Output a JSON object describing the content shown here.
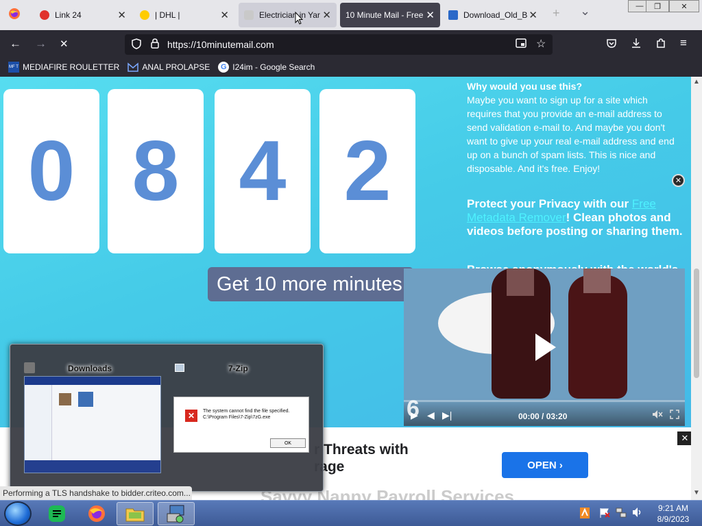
{
  "tabs": [
    {
      "label": "Link 24",
      "favicon_color": "#e0312b"
    },
    {
      "label": "| DHL |",
      "favicon_color": "#ffcc00"
    },
    {
      "label": "Electrician in Yar",
      "favicon_color": "#c9c9c9"
    },
    {
      "label": "10 Minute Mail - Free",
      "favicon_color": ""
    },
    {
      "label": "Download_Old_B",
      "favicon_color": "#2a68c8"
    }
  ],
  "tab_close_glyph": "✕",
  "new_tab_glyph": "+",
  "tab_list_glyph": "⌄",
  "window_controls": {
    "minimize": "—",
    "restore": "❐",
    "close": "✕"
  },
  "nav": {
    "back": "←",
    "forward": "→",
    "stop": "✕",
    "url": "https://10minutemail.com"
  },
  "bookmarks": [
    {
      "label": "MEDIAFIRE ROULETTER",
      "icon": "MF T"
    },
    {
      "label": "ANAL PROLAPSE",
      "icon": ""
    },
    {
      "label": "I24im - Google Search",
      "icon": "G"
    }
  ],
  "timer_digits": [
    "0",
    "8",
    "4",
    "2"
  ],
  "get_more_label": "Get 10 more minutes",
  "info": {
    "title": "Why would you use this?",
    "text": "Maybe you want to sign up for a site which requires that you provide an e-mail address to send validation e-mail to. And maybe you don't want to give up your real e-mail address and end up on a bunch of spam lists. This is nice and disposable. And it's free. Enjoy!",
    "privacy_prefix": "Protect your Privacy with our ",
    "privacy_link": "Free Metadata Remover",
    "privacy_suffix": "! Clean photos and videos before posting or sharing them.",
    "browse": "Browse anonymously with the world's"
  },
  "video": {
    "close_glyph": "✕",
    "time": "00:00 / 03:20",
    "badge": "6",
    "progress": 0
  },
  "banner": {
    "text_line1": "r Threats with",
    "text_line2": "rage",
    "open_label": "OPEN ›",
    "close_glyph": "✕",
    "behind_text": "Savvy Nanny Payroll Services"
  },
  "preview": {
    "window1_title": "Downloads",
    "window2_title": "7-Zip",
    "error_line1": "The system cannot find the file specified.",
    "error_line2": "C:\\Program Files\\7-Zip\\7zG.exe",
    "ok_label": "OK",
    "error_glyph": "✕"
  },
  "status_text": "Performing a TLS handshake to bidder.criteo.com...",
  "clock": {
    "time": "9:21 AM",
    "date": "8/9/2023"
  },
  "colors": {
    "accent_blue": "#1a73e8",
    "digit": "#5b8ed6",
    "page_bg": "#45cbe8"
  }
}
